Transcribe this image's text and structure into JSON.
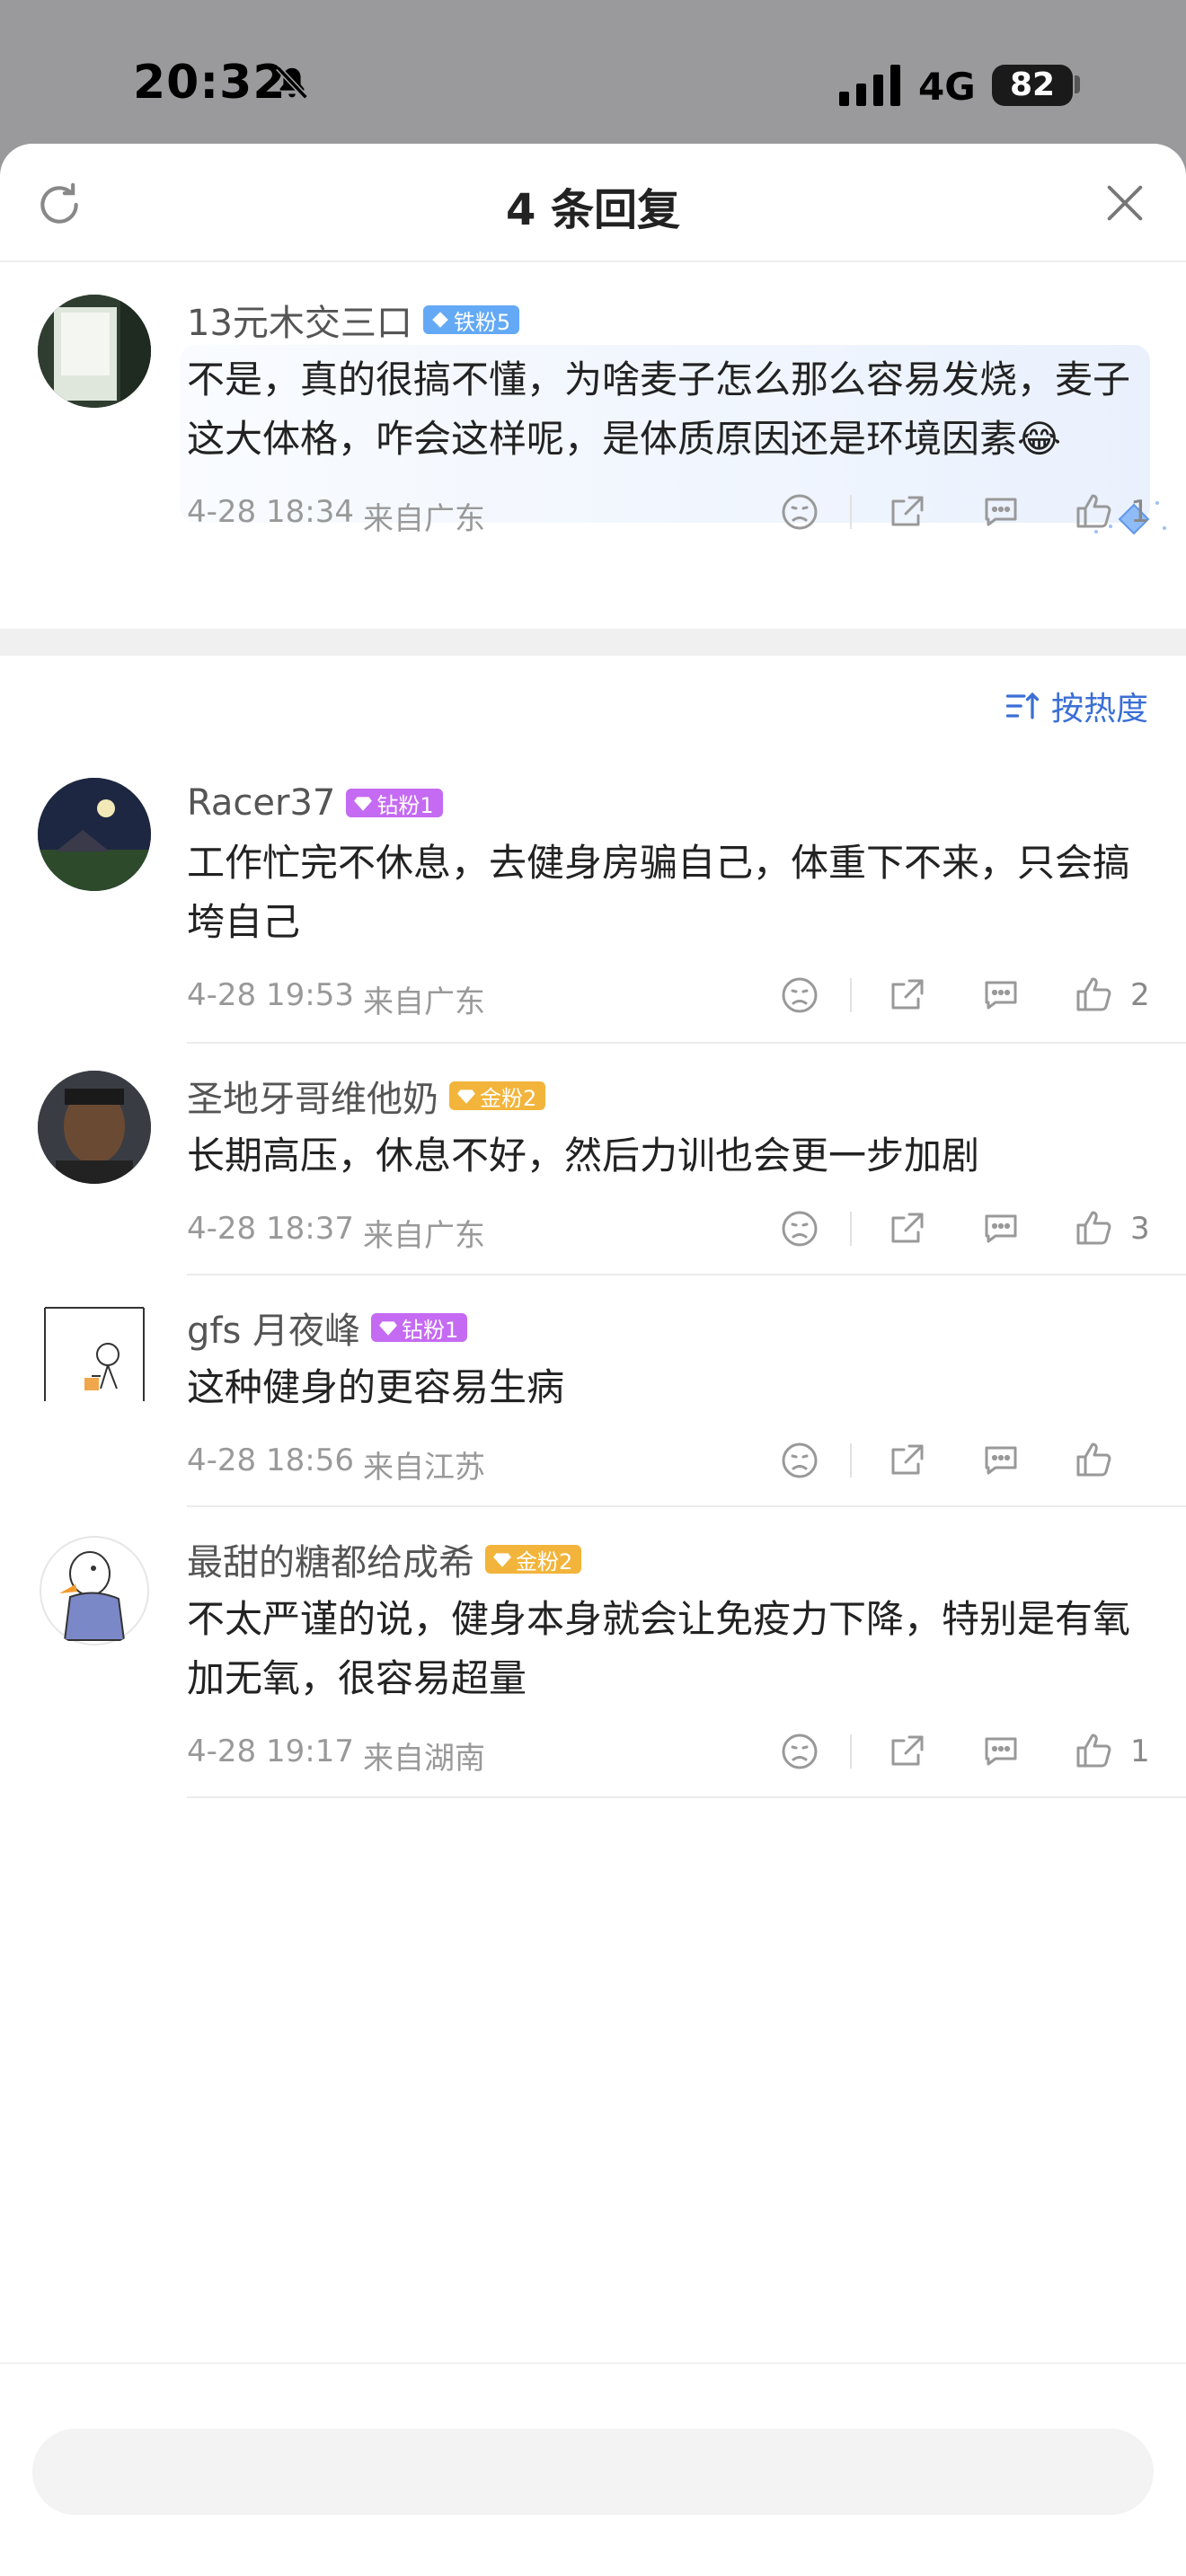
{
  "status_bar": {
    "time": "20:32",
    "network": "4G",
    "battery": "82"
  },
  "header": {
    "title": "4 条回复"
  },
  "sort": {
    "label": "按热度"
  },
  "comments": [
    {
      "name": "13元木交三口",
      "badge": "铁粉5",
      "text": "不是，真的很搞不懂，为啥麦子怎么那么容易发烧，麦子这大体格，咋会这样呢，是体质原因还是环境因素😂",
      "time": "4-28 18:34",
      "location": "来自广东",
      "likes": "1"
    },
    {
      "name": "Racer37",
      "badge": "钻粉1",
      "text": "工作忙完不休息，去健身房骗自己，体重下不来，只会搞垮自己",
      "time": "4-28 19:53",
      "location": "来自广东",
      "likes": "2"
    },
    {
      "name": "圣地牙哥维他奶",
      "badge": "金粉2",
      "text": "长期高压，休息不好，然后力训也会更一步加剧",
      "time": "4-28 18:37",
      "location": "来自广东",
      "likes": "3"
    },
    {
      "name": "gfs 月夜峰",
      "badge": "钻粉1",
      "text": "这种健身的更容易生病",
      "time": "4-28 18:56",
      "location": "来自江苏",
      "likes": ""
    },
    {
      "name": "最甜的糖都给成希",
      "badge": "金粉2",
      "text": "不太严谨的说，健身本身就会让免疫力下降，特别是有氧加无氧，很容易超量",
      "time": "4-28 19:17",
      "location": "来自湖南",
      "likes": "1"
    }
  ],
  "reply_input": {
    "placeholder": ""
  },
  "colors": {
    "accent": "#3b6fd6",
    "iron_badge": "#63a9f5",
    "diamond_badge": "#c56af2",
    "gold_badge": "#f2b43b"
  }
}
